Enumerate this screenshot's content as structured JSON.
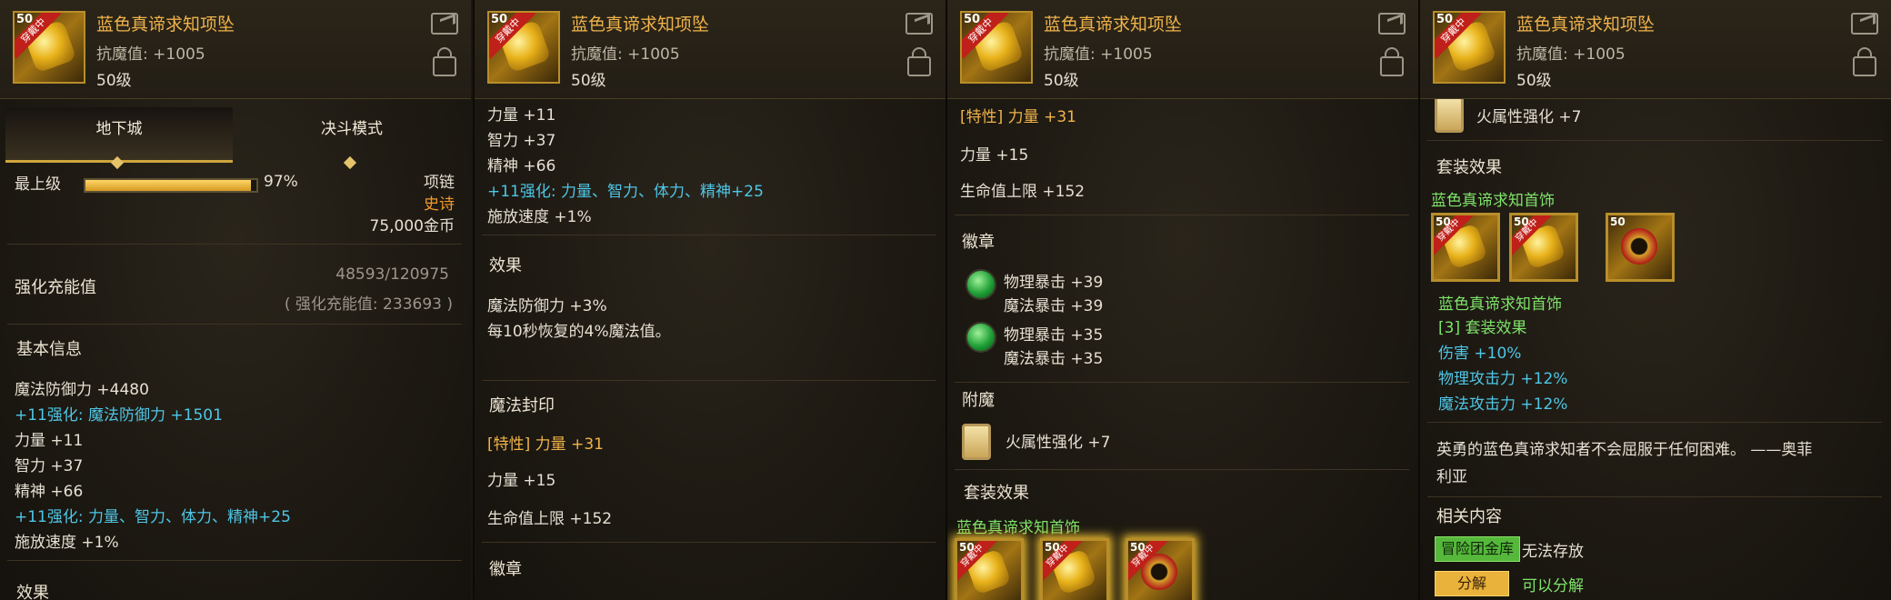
{
  "item": {
    "name": "蓝色真谛求知项坠",
    "stat": "抗魔值: +1005",
    "level": "50级",
    "icon_level": "50",
    "equipped_ribbon": "穿戴中"
  },
  "panel1": {
    "tabs": [
      "地下城",
      "决斗模式"
    ],
    "upgrade_label": "最上级",
    "progress_percent": 97,
    "progress_text": "97%",
    "slot": "项链",
    "rarity": "史诗",
    "price": "75,000金币",
    "reinforce_label": "强化充能值",
    "reinforce_value": "48593/120975",
    "reinforce_total": "( 强化充能值: 233693 )",
    "basic_info_title": "基本信息",
    "basic_lines": [
      "魔法防御力 +4480",
      "+11强化: 魔法防御力 +1501",
      "力量 +11",
      "智力 +37",
      "精神 +66",
      "+11强化: 力量、智力、体力、精神+25",
      "施放速度 +1%"
    ],
    "cut_title": "效果"
  },
  "panel2": {
    "lines_top": [
      "力量 +11",
      "智力 +37",
      "精神 +66",
      "+11强化: 力量、智力、体力、精神+25",
      "施放速度 +1%"
    ],
    "effect_title": "效果",
    "effect_lines": [
      "魔法防御力 +3%",
      "每10秒恢复的4%魔法值。"
    ],
    "seal_title": "魔法封印",
    "seal_special": "[特性] 力量 +31",
    "seal_lines": [
      "力量 +15",
      "生命值上限 +152"
    ],
    "emblem_title": "徽章"
  },
  "panel3": {
    "seal_special": "[特性] 力量 +31",
    "seal_lines": [
      "力量 +15",
      "生命值上限 +152"
    ],
    "emblem_title": "徽章",
    "emblem1": [
      "物理暴击 +39",
      "魔法暴击 +39"
    ],
    "emblem2": [
      "物理暴击 +35",
      "魔法暴击 +35"
    ],
    "enchant_title": "附魔",
    "enchant_text": "火属性强化 +7",
    "set_title": "套装效果",
    "set_name": "蓝色真谛求知首饰"
  },
  "panel4": {
    "enchant_text": "火属性强化 +7",
    "set_title": "套装效果",
    "set_name": "蓝色真谛求知首饰",
    "set_name2": "蓝色真谛求知首饰",
    "set_count": "[3] 套装效果",
    "set_bonus": [
      "伤害 +10%",
      "物理攻击力 +12%",
      "魔法攻击力 +12%"
    ],
    "flavor_line1": "英勇的蓝色真谛求知者不会屈服于任何困难。 ——奥菲",
    "flavor_line2": "利亚",
    "related_title": "相关内容",
    "badge1": "冒险团金库",
    "badge1_text": "无法存放",
    "badge2": "分解",
    "badge2_text": "可以分解"
  }
}
